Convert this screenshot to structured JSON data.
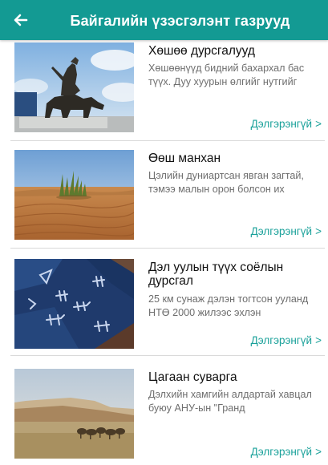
{
  "header": {
    "title": "Байгалийн үзэсгэлэнт газрууд",
    "back_icon": "arrow-left-icon",
    "color": "#139a93"
  },
  "items": [
    {
      "title": "Хөшөө дурсгалууд",
      "description": "Хөшөөнүүд бидний бахархал бас түүх. Дуу хуурын өлгийг нутгийг",
      "more": "Дэлгэрэнгүй",
      "chevron": ">"
    },
    {
      "title": "Өөш манхан",
      "description": "Цэлийн дуниартсан явган загтай, тэмээ малын орон болсон их",
      "more": "Дэлгэрэнгүй",
      "chevron": ">"
    },
    {
      "title": "Дэл уулын түүх соёлын дурсгал",
      "description": "25 км сунаж дэлэн тогтсон ууланд НТӨ 2000 жилээс эхлэн",
      "more": "Дэлгэрэнгүй",
      "chevron": ">"
    },
    {
      "title": "Цагаан суварга",
      "description": "Дэлхийн хамгийн алдартай хавцал буюу АНУ-ын \"Гранд",
      "more": "Дэлгэрэнгүй",
      "chevron": ">"
    }
  ],
  "accent_color": "#1aa19a"
}
